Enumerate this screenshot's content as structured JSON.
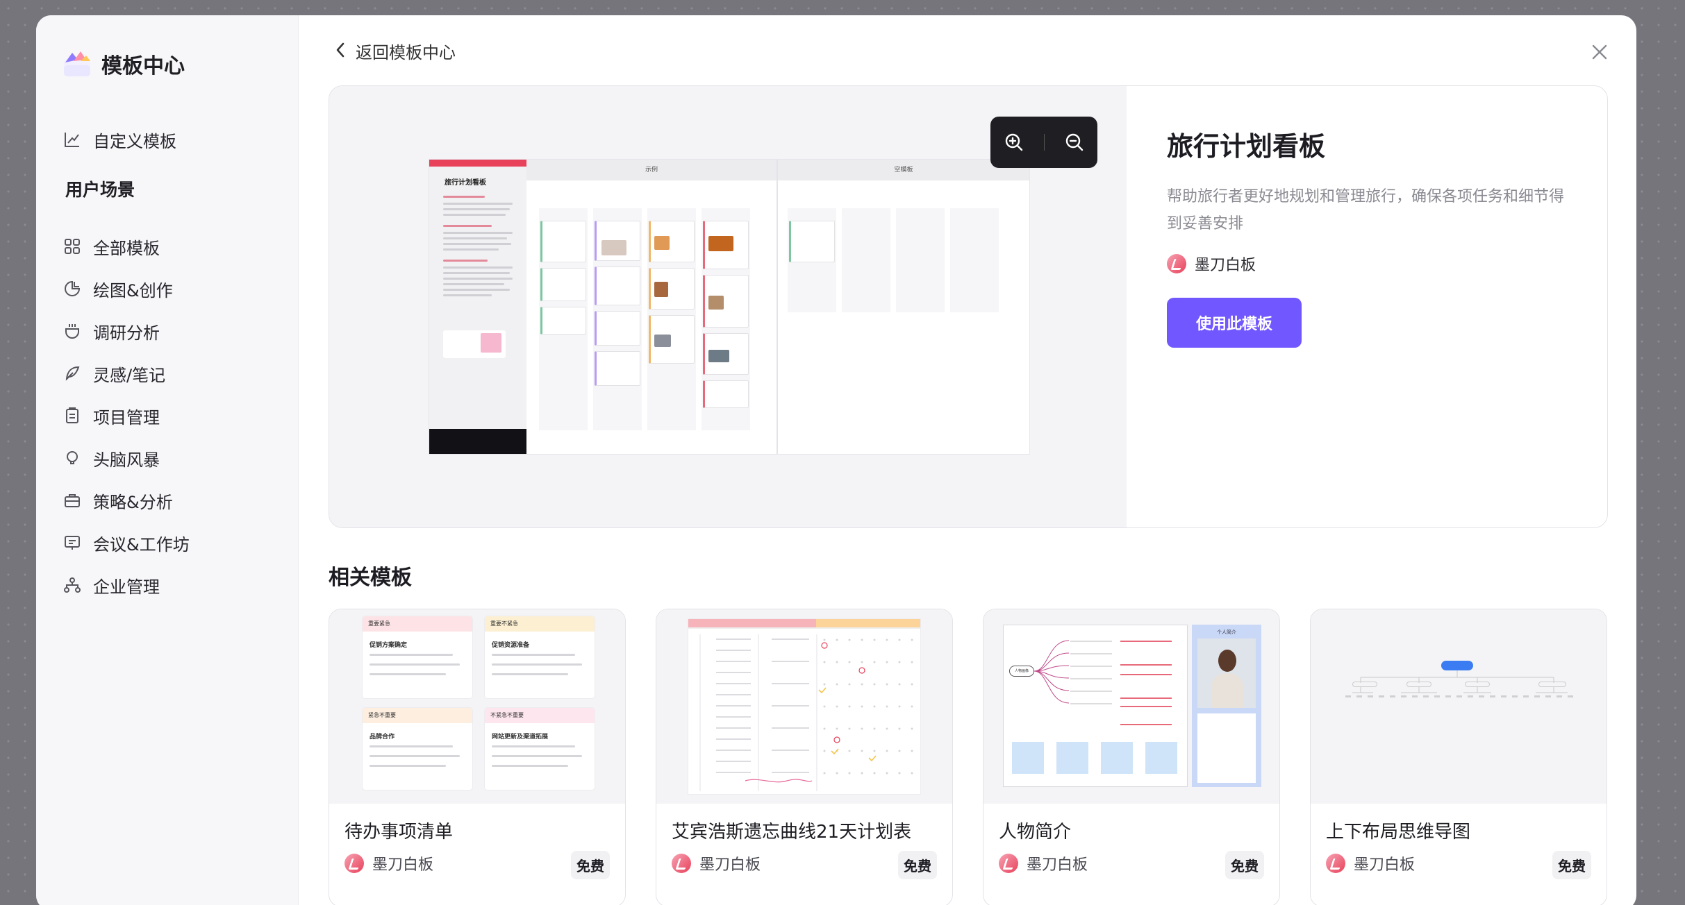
{
  "sidebar": {
    "brand": "模板中心",
    "custom_label": "自定义模板",
    "section_title": "用户场景",
    "items": [
      {
        "label": "全部模板",
        "icon": "grid-icon"
      },
      {
        "label": "绘图&创作",
        "icon": "palette-icon"
      },
      {
        "label": "调研分析",
        "icon": "cup-icon"
      },
      {
        "label": "灵感/笔记",
        "icon": "feather-icon"
      },
      {
        "label": "项目管理",
        "icon": "clipboard-icon"
      },
      {
        "label": "头脑风暴",
        "icon": "bulb-icon"
      },
      {
        "label": "策略&分析",
        "icon": "briefcase-icon"
      },
      {
        "label": "会议&工作坊",
        "icon": "presentation-icon"
      },
      {
        "label": "企业管理",
        "icon": "org-icon"
      }
    ]
  },
  "header": {
    "back_label": "返回模板中心"
  },
  "hero": {
    "title": "旅行计划看板",
    "description": "帮助旅行者更好地规划和管理旅行，确保各项任务和细节得到妥善安排",
    "author": "墨刀白板",
    "use_button": "使用此模板",
    "preview": {
      "left_title": "旅行计划看板",
      "col_example": "示例",
      "col_blank": "空模板"
    }
  },
  "related": {
    "title": "相关模板",
    "cards": [
      {
        "title": "待办事项清单",
        "author": "墨刀白板",
        "badge": "免费",
        "quads": [
          {
            "head": "重要紧急",
            "title": "促销方案确定",
            "color": "#fde3e6"
          },
          {
            "head": "重要不紧急",
            "title": "促销资源准备",
            "color": "#fdf0d2"
          },
          {
            "head": "紧急不重要",
            "title": "品牌合作",
            "color": "#fdeee0"
          },
          {
            "head": "不紧急不重要",
            "title": "网站更新及渠道拓展",
            "color": "#fde6ee"
          }
        ]
      },
      {
        "title": "艾宾浩斯遗忘曲线21天计划表",
        "author": "墨刀白板",
        "badge": "免费"
      },
      {
        "title": "人物简介",
        "author": "墨刀白板",
        "badge": "免费",
        "profile_label": "个人简介",
        "node_label": "人物画像"
      },
      {
        "title": "上下布局思维导图",
        "author": "墨刀白板",
        "badge": "免费"
      }
    ]
  },
  "colors": {
    "accent": "#7057ff",
    "brand_red": "#e8415a",
    "toolbar_dark": "#1f1f23"
  }
}
